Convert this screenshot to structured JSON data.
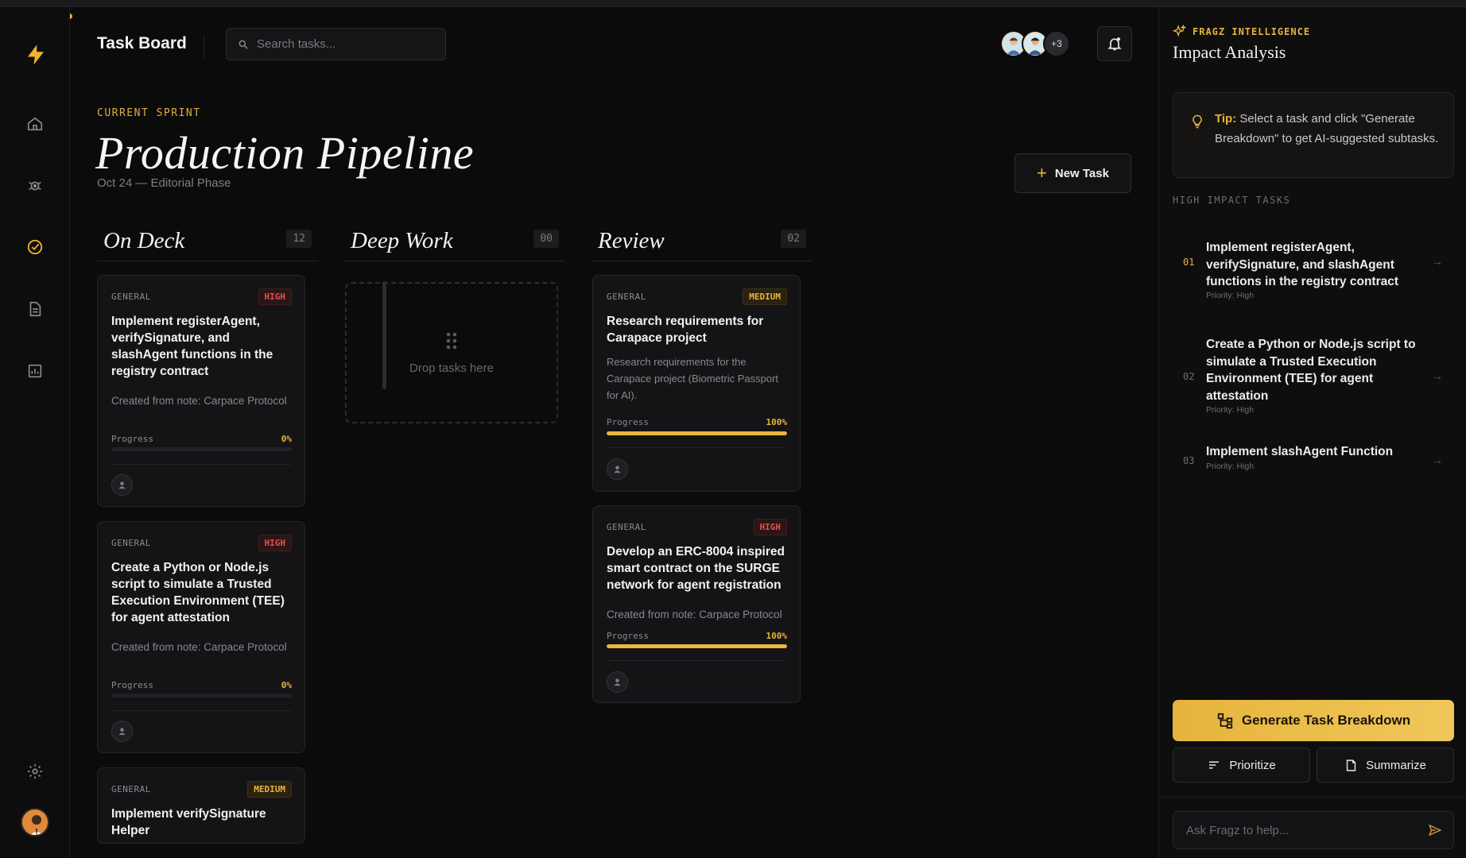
{
  "app": {
    "accent": "#f0b429"
  },
  "sidebar": {
    "items": [
      {
        "name": "home-icon"
      },
      {
        "name": "agents-icon"
      },
      {
        "name": "tasks-icon",
        "active": true
      },
      {
        "name": "notes-icon"
      },
      {
        "name": "analytics-icon"
      }
    ],
    "bottom": [
      {
        "name": "settings-icon"
      },
      {
        "name": "user-avatar"
      }
    ]
  },
  "header": {
    "title": "Task Board",
    "search_placeholder": "Search tasks...",
    "team_extra": "+3"
  },
  "sprint": {
    "kicker": "CURRENT SPRINT",
    "title": "Production Pipeline",
    "subtitle": "Oct 24 — Editorial Phase",
    "new_task_label": "New Task"
  },
  "columns": [
    {
      "name": "On Deck",
      "count": "12",
      "cards": [
        {
          "category": "GENERAL",
          "priority": "HIGH",
          "title": "Implement registerAgent, verifySignature, and slashAgent functions in the registry contract",
          "desc": "Created from note: Carpace Protocol",
          "progress_label": "Progress",
          "progress": "0%"
        },
        {
          "category": "GENERAL",
          "priority": "HIGH",
          "title": "Create a Python or Node.js script to simulate a Trusted Execution Environment (TEE) for agent attestation",
          "desc": "Created from note: Carpace Protocol",
          "progress_label": "Progress",
          "progress": "0%"
        },
        {
          "category": "GENERAL",
          "priority": "MEDIUM",
          "title": "Implement verifySignature Helper"
        }
      ]
    },
    {
      "name": "Deep Work",
      "count": "00",
      "empty_text": "Drop tasks here"
    },
    {
      "name": "Review",
      "count": "02",
      "cards": [
        {
          "category": "GENERAL",
          "priority": "MEDIUM",
          "title": "Research requirements for Carapace project",
          "desc": "Research requirements for the Carapace project (Biometric Passport for AI).",
          "progress_label": "Progress",
          "progress": "100%"
        },
        {
          "category": "GENERAL",
          "priority": "HIGH",
          "title": "Develop an ERC-8004 inspired smart contract on the SURGE network for agent registration",
          "desc": "Created from note: Carpace Protocol",
          "progress_label": "Progress",
          "progress": "100%"
        }
      ]
    }
  ],
  "panel": {
    "kicker": "FRAGZ INTELLIGENCE",
    "title": "Impact Analysis",
    "tip_label": "Tip:",
    "tip_text": "Select a task and click \"Generate Breakdown\" to get AI-suggested subtasks.",
    "section_label": "HIGH IMPACT TASKS",
    "items": [
      {
        "num": "01",
        "title": "Implement registerAgent, verifySignature, and slashAgent functions in the registry contract",
        "priority": "Priority: High"
      },
      {
        "num": "02",
        "title": "Create a Python or Node.js script to simulate a Trusted Execution Environment (TEE) for agent attestation",
        "priority": "Priority: High"
      },
      {
        "num": "03",
        "title": "Implement slashAgent Function",
        "priority": "Priority: High"
      }
    ],
    "generate_label": "Generate Task Breakdown",
    "prioritize_label": "Prioritize",
    "summarize_label": "Summarize",
    "ask_placeholder": "Ask Fragz to help..."
  }
}
